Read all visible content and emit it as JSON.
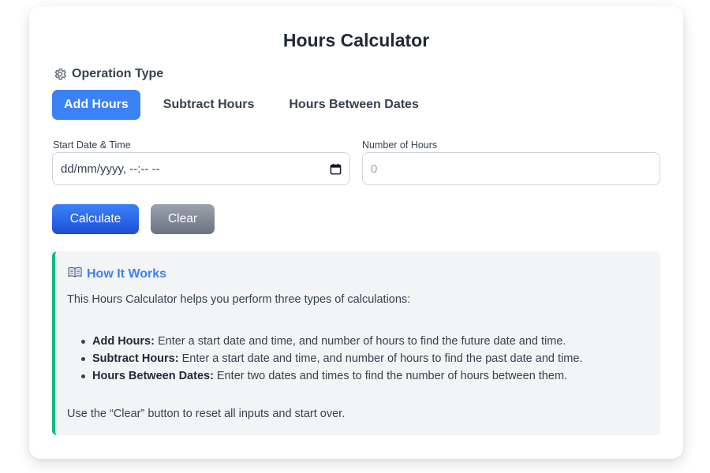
{
  "app": {
    "title": "Hours Calculator"
  },
  "operation": {
    "heading": "Operation Type",
    "tabs": [
      {
        "label": "Add Hours",
        "active": true
      },
      {
        "label": "Subtract Hours",
        "active": false
      },
      {
        "label": "Hours Between Dates",
        "active": false
      }
    ]
  },
  "form": {
    "start": {
      "label": "Start Date & Time",
      "placeholder": "dd/mm/yyyy, --:-- --",
      "value": ""
    },
    "hours": {
      "label": "Number of Hours",
      "placeholder": "0",
      "value": ""
    }
  },
  "buttons": {
    "calculate": "Calculate",
    "clear": "Clear"
  },
  "info": {
    "heading": "How It Works",
    "intro": "This Hours Calculator helps you perform three types of calculations:",
    "items": [
      {
        "term": "Add Hours:",
        "desc": " Enter a start date and time, and number of hours to find the future date and time."
      },
      {
        "term": "Subtract Hours:",
        "desc": " Enter a start date and time, and number of hours to find the past date and time."
      },
      {
        "term": "Hours Between Dates:",
        "desc": " Enter two dates and times to find the number of hours between them."
      }
    ],
    "footer": "Use the “Clear” button to reset all inputs and start over."
  },
  "colors": {
    "accent": "#3b82f6",
    "accent_dark": "#1d4ed8",
    "clear_button": "#9ca3af",
    "info_border": "#10b981",
    "info_bg": "#f3f4f6"
  },
  "icons": {
    "operation": "gear-icon",
    "info": "open-book-icon",
    "date_picker": "calendar-icon"
  }
}
